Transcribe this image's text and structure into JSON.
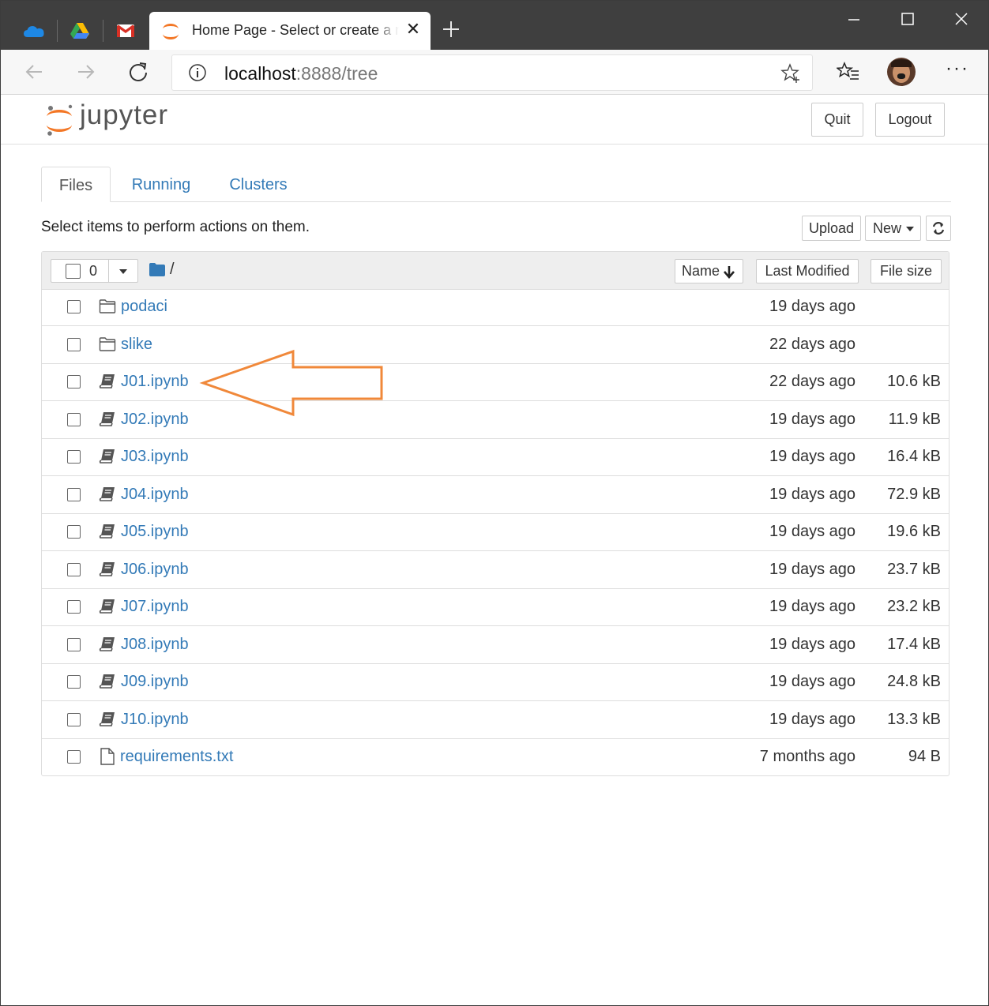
{
  "browser": {
    "active_tab_title": "Home Page - Select or create a new notebook",
    "url_host": "localhost",
    "url_rest": ":8888/tree"
  },
  "header": {
    "logo_text": "jupyter",
    "quit_label": "Quit",
    "logout_label": "Logout"
  },
  "tabs": [
    {
      "label": "Files"
    },
    {
      "label": "Running"
    },
    {
      "label": "Clusters"
    }
  ],
  "hint": "Select items to perform actions on them.",
  "toolbar": {
    "upload_label": "Upload",
    "new_label": "New"
  },
  "list_header": {
    "selected_count": "0",
    "path": "/",
    "name_label": "Name",
    "modified_label": "Last Modified",
    "size_label": "File size"
  },
  "files": [
    {
      "name": "podaci",
      "type": "folder",
      "modified": "19 days ago",
      "size": ""
    },
    {
      "name": "slike",
      "type": "folder",
      "modified": "22 days ago",
      "size": ""
    },
    {
      "name": "J01.ipynb",
      "type": "notebook",
      "modified": "22 days ago",
      "size": "10.6 kB"
    },
    {
      "name": "J02.ipynb",
      "type": "notebook",
      "modified": "19 days ago",
      "size": "11.9 kB"
    },
    {
      "name": "J03.ipynb",
      "type": "notebook",
      "modified": "19 days ago",
      "size": "16.4 kB"
    },
    {
      "name": "J04.ipynb",
      "type": "notebook",
      "modified": "19 days ago",
      "size": "72.9 kB"
    },
    {
      "name": "J05.ipynb",
      "type": "notebook",
      "modified": "19 days ago",
      "size": "19.6 kB"
    },
    {
      "name": "J06.ipynb",
      "type": "notebook",
      "modified": "19 days ago",
      "size": "23.7 kB"
    },
    {
      "name": "J07.ipynb",
      "type": "notebook",
      "modified": "19 days ago",
      "size": "23.2 kB"
    },
    {
      "name": "J08.ipynb",
      "type": "notebook",
      "modified": "19 days ago",
      "size": "17.4 kB"
    },
    {
      "name": "J09.ipynb",
      "type": "notebook",
      "modified": "19 days ago",
      "size": "24.8 kB"
    },
    {
      "name": "J10.ipynb",
      "type": "notebook",
      "modified": "19 days ago",
      "size": "13.3 kB"
    },
    {
      "name": "requirements.txt",
      "type": "file",
      "modified": "7 months ago",
      "size": "94 B"
    }
  ],
  "colors": {
    "link": "#337ab7",
    "annotation_arrow": "#f0883a",
    "jupyter_orange": "#f37726",
    "tabbar": "#3f3f3f"
  }
}
